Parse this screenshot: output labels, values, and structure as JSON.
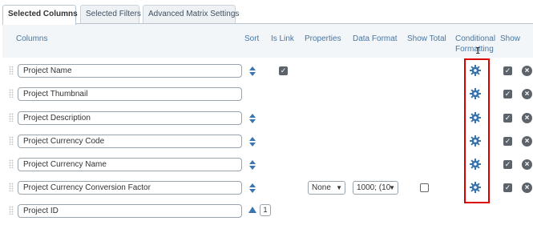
{
  "tabs": [
    {
      "label": "Selected Columns",
      "active": true
    },
    {
      "label": "Selected Filters",
      "active": false
    },
    {
      "label": "Advanced Matrix Settings",
      "active": false
    }
  ],
  "headers": {
    "columns": "Columns",
    "sort": "Sort",
    "is_link": "Is Link",
    "properties": "Properties",
    "data_format": "Data Format",
    "show_total": "Show Total",
    "conditional_formatting_1": "Conditional",
    "conditional_formatting_2": "Formatting",
    "show": "Show"
  },
  "rows": [
    {
      "name": "Project Name",
      "sort": "both",
      "is_link": true,
      "show": true
    },
    {
      "name": "Project Thumbnail",
      "sort": "none",
      "is_link": false,
      "show": true
    },
    {
      "name": "Project Description",
      "sort": "both",
      "is_link": false,
      "show": true
    },
    {
      "name": "Project Currency Code",
      "sort": "both",
      "is_link": false,
      "show": true
    },
    {
      "name": "Project Currency Name",
      "sort": "both",
      "is_link": false,
      "show": true
    },
    {
      "name": "Project Currency Conversion Factor",
      "sort": "both",
      "is_link": false,
      "show": true,
      "properties_value": "None",
      "data_format_value": "1000; (10",
      "show_total": false
    },
    {
      "name": "Project ID",
      "sort": "asc",
      "sort_order": "1",
      "is_link": false
    }
  ],
  "colors": {
    "header_bg": "#f2f6f9",
    "header_text": "#4876a3",
    "accent_blue": "#3a75b0",
    "highlight_red": "#d90000"
  },
  "icons": {
    "sort": "sort-updown-icon",
    "gear": "gear-icon",
    "remove": "remove-circle-icon",
    "drag": "drag-handle-icon"
  }
}
